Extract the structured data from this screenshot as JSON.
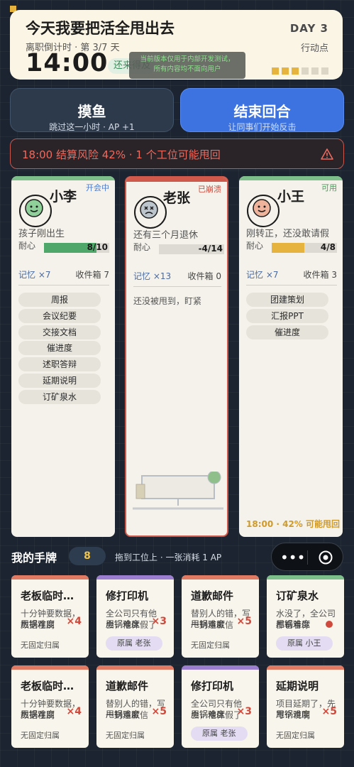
{
  "header": {
    "title": "今天我要把活全甩出去",
    "subtitle": "离职倒计时 · 第 3/7 天",
    "clock": "14:00",
    "late_chip": "还来得及",
    "dev_note_line1": "当前版本仅用于内部开发测试，",
    "dev_note_line2": "所有内容均不面向用户",
    "day": "DAY 3",
    "ap_label": "行动点",
    "ap_filled": 3,
    "ap_total": 6,
    "ap_color": "#e6b43e",
    "ap_empty_color": "#dcd6c6"
  },
  "actions": {
    "slack_label": "摸鱼",
    "slack_sub": "跳过这一小时 · AP +1",
    "end_label": "结束回合",
    "end_sub": "让同事们开始反击"
  },
  "risk": {
    "text": "18:00 结算风险 42% · 1 个工位可能甩回",
    "icon": "warning-icon"
  },
  "stations": [
    {
      "name": "小李",
      "status": "开会中",
      "status_color": "#4a7ad0",
      "top_color": "#7dbf8a",
      "avatar": "smile-face-icon",
      "avatar_color": "#8fcf9a",
      "desc": "孩子刚出生",
      "patience_label": "耐心",
      "patience_value": 8,
      "patience_max": 10,
      "patience_text": "8/10",
      "bar_color": "#4fa86a",
      "memory": "记忆 ×7",
      "inbox": "收件箱 7",
      "tasks": [
        "周报",
        "会议纪要",
        "交接文档",
        "催进度",
        "述职答辩",
        "延期说明",
        "订矿泉水"
      ]
    },
    {
      "name": "老张",
      "status": "已崩溃",
      "status_color": "#cf4a3c",
      "top_color": "#cf5a4c",
      "avatar": "crossed-eyes-face-icon",
      "avatar_color": "#bcc4cc",
      "desc": "还有三个月退休",
      "patience_label": "耐心",
      "patience_value": -4,
      "patience_max": 14,
      "patience_text": "-4/14",
      "bar_color": "#a0a0a0",
      "memory": "记忆 ×13",
      "inbox": "收件箱 0",
      "note": "还没被甩到，盯紧"
    },
    {
      "name": "小王",
      "status": "可用",
      "status_color": "#4a9a5a",
      "top_color": "#7dbf8a",
      "avatar": "smile-face-icon",
      "avatar_color": "#eeb39a",
      "desc": "刚转正，还没敢请假",
      "patience_label": "耐心",
      "patience_value": 4,
      "patience_max": 8,
      "patience_text": "4/8",
      "bar_color": "#e6b43e",
      "memory": "记忆 ×7",
      "inbox": "收件箱 3",
      "tasks": [
        "团建策划",
        "汇报PPT",
        "催进度"
      ],
      "foot": "18:00 · 42% 可能甩回"
    }
  ],
  "hand": {
    "title": "我的手牌",
    "count": "8",
    "hint": "拖到工位上 · 一张消耗 1 AP",
    "cards": [
      {
        "title": "老板临时…",
        "desc": "十分钟要数据，数据在别",
        "diff": "甩锅难度",
        "mult": "×4",
        "owner": "无固定归属",
        "top": "#e07a62"
      },
      {
        "title": "修打印机",
        "desc": "全公司只有他会，他休假了",
        "diff": "甩锅难度",
        "mult": "×3",
        "owner": "原属 老张",
        "owner_chip": true,
        "top": "#9b7ed0"
      },
      {
        "title": "道歉邮件",
        "desc": "替别人的错，写一封道歉信",
        "diff": "甩锅难度",
        "mult": "×5",
        "owner": "无固定归属",
        "top": "#e07a62"
      },
      {
        "title": "订矿泉水",
        "desc": "水没了，全公司都看着你",
        "diff": "甩锅难度",
        "mult": "",
        "owner": "原属 小王",
        "owner_chip": true,
        "dot": true,
        "top": "#7dbf8a"
      },
      {
        "title": "老板临时…",
        "desc": "十分钟要数据，数据在别",
        "diff": "甩锅难度",
        "mult": "×4",
        "owner": "无固定归属",
        "top": "#e07a62"
      },
      {
        "title": "道歉邮件",
        "desc": "替别人的错，写一封道歉信",
        "diff": "甩锅难度",
        "mult": "×5",
        "owner": "无固定归属",
        "top": "#e07a62"
      },
      {
        "title": "修打印机",
        "desc": "全公司只有他会，他休假了",
        "diff": "甩锅难度",
        "mult": "×3",
        "owner": "原属 老张",
        "owner_chip": true,
        "top": "#9b7ed0"
      },
      {
        "title": "延期说明",
        "desc": "项目延期了，先写个说明",
        "diff": "甩锅难度",
        "mult": "×5",
        "owner": "无固定归属",
        "top": "#e07a62"
      }
    ]
  },
  "capsule": {
    "more_icon": "more-dots-icon",
    "close_icon": "target-circle-icon"
  }
}
